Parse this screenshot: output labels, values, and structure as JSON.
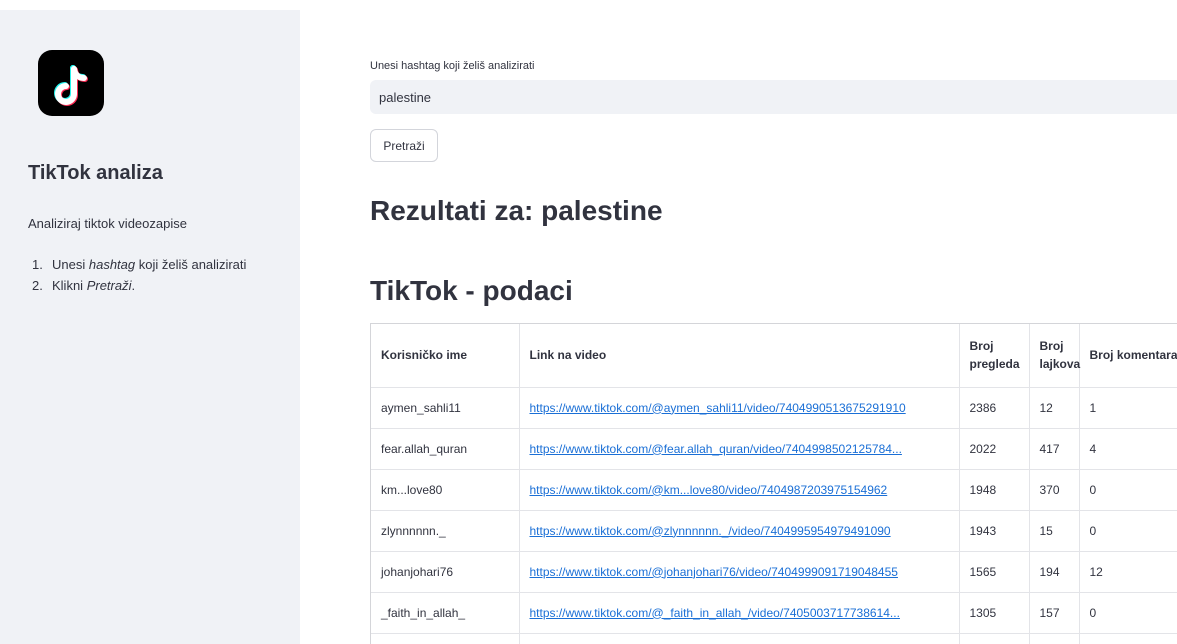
{
  "sidebar": {
    "logo_icon": "tiktok-logo-icon",
    "title": "TikTok analiza",
    "description": "Analiziraj tiktok videozapise",
    "steps": [
      {
        "num": "1.",
        "pre": "Unesi ",
        "em": "hashtag",
        "post": " koji želiš analizirati"
      },
      {
        "num": "2.",
        "pre": "Klikni ",
        "em": "Pretraži",
        "post": "."
      }
    ]
  },
  "search": {
    "label": "Unesi hashtag koji želiš analizirati",
    "value": "palestine"
  },
  "search_button": "Pretraži",
  "results_heading": "Rezultati za: palestine",
  "data_heading": "TikTok - podaci",
  "table": {
    "headers": [
      "Korisničko ime",
      "Link na video",
      "Broj pregleda",
      "Broj lajkova",
      "Broj komentara"
    ],
    "rows": [
      [
        "aymen_sahli11",
        "https://www.tiktok.com/@aymen_sahli11/video/7404990513675291910",
        "2386",
        "12",
        "1"
      ],
      [
        "fear.allah_quran",
        "https://www.tiktok.com/@fear.allah_quran/video/7404998502125784...",
        "2022",
        "417",
        "4"
      ],
      [
        "km...love80",
        "https://www.tiktok.com/@km...love80/video/7404987203975154962",
        "1948",
        "370",
        "0"
      ],
      [
        "zlynnnnnn._",
        "https://www.tiktok.com/@zlynnnnnn._/video/7404995954979491090",
        "1943",
        "15",
        "0"
      ],
      [
        "johanjohari76",
        "https://www.tiktok.com/@johanjohari76/video/7404999091719048455",
        "1565",
        "194",
        "12"
      ],
      [
        "_faith_in_allah_",
        "https://www.tiktok.com/@_faith_in_allah_/video/7405003717738614...",
        "1305",
        "157",
        "0"
      ]
    ]
  },
  "colors": {
    "sidebar_bg": "#f0f2f6",
    "link": "#1a6fd6",
    "text": "#31333f"
  }
}
